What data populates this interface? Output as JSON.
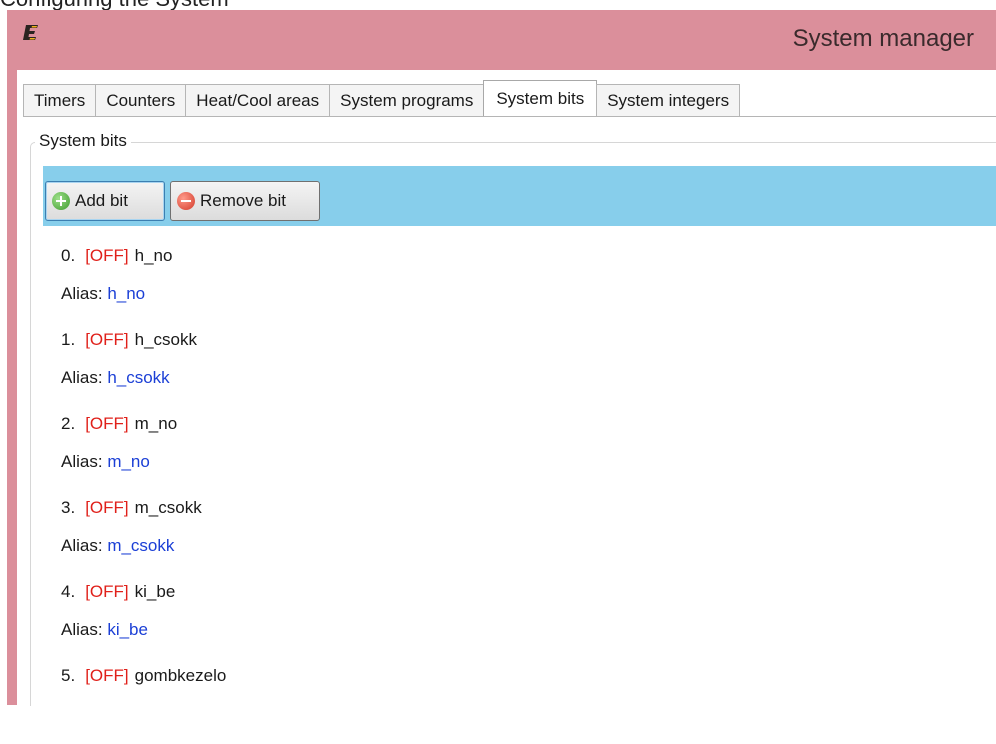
{
  "page_header": "Configuring the System",
  "window": {
    "title": "System manager",
    "logo_icon": "e-logo-icon"
  },
  "tabs": [
    {
      "label": "Timers"
    },
    {
      "label": "Counters"
    },
    {
      "label": "Heat/Cool areas"
    },
    {
      "label": "System programs"
    },
    {
      "label": "System bits",
      "active": true
    },
    {
      "label": "System integers"
    }
  ],
  "group": {
    "title": "System bits"
  },
  "toolbar": {
    "add_label": "Add bit",
    "add_icon": "plus-circle-icon",
    "remove_label": "Remove bit",
    "remove_icon": "minus-circle-icon",
    "background": "#87ceeb"
  },
  "bits": [
    {
      "index": "0.",
      "state": "[OFF]",
      "name": "h_no",
      "alias_label": "Alias:",
      "alias": "h_no"
    },
    {
      "index": "1.",
      "state": "[OFF]",
      "name": "h_csokk",
      "alias_label": "Alias:",
      "alias": "h_csokk"
    },
    {
      "index": "2.",
      "state": "[OFF]",
      "name": "m_no",
      "alias_label": "Alias:",
      "alias": "m_no"
    },
    {
      "index": "3.",
      "state": "[OFF]",
      "name": "m_csokk",
      "alias_label": "Alias:",
      "alias": "m_csokk"
    },
    {
      "index": "4.",
      "state": "[OFF]",
      "name": "ki_be",
      "alias_label": "Alias:",
      "alias": "ki_be"
    },
    {
      "index": "5.",
      "state": "[OFF]",
      "name": "gombkezelo"
    }
  ],
  "colors": {
    "titlebar": "#db8f9b",
    "state_off": "#e0201a",
    "alias_value": "#1b3fd6"
  }
}
